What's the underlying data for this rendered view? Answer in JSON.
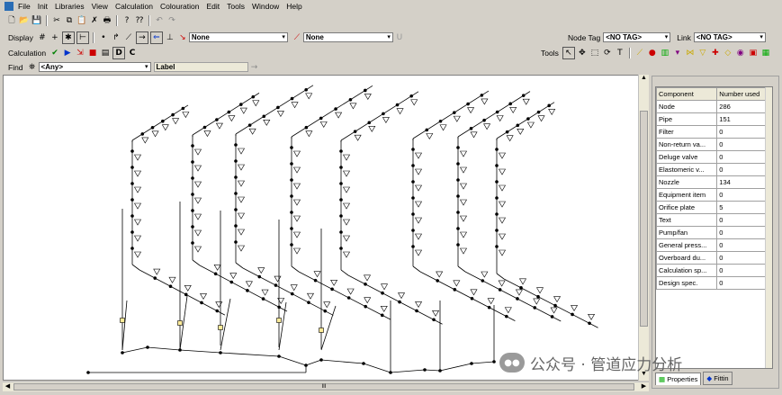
{
  "menu": [
    "File",
    "Init",
    "Libraries",
    "View",
    "Calculation",
    "Colouration",
    "Edit",
    "Tools",
    "Window",
    "Help"
  ],
  "display_toolbar": {
    "label": "Display",
    "combo1_value": "None",
    "combo2_value": "None",
    "node_tag_label": "Node Tag",
    "node_tag_value": "<NO TAG>",
    "link_label": "Link",
    "link_value": "<NO TAG>"
  },
  "calc_toolbar": {
    "label": "Calculation",
    "d_label": "D",
    "c_label": "C",
    "tools_label": "Tools"
  },
  "find_toolbar": {
    "label": "Find",
    "combo_value": "<Any>",
    "field_label": "Label"
  },
  "hscroll_grip": "III",
  "properties_panel": {
    "header": [
      "Component",
      "Number used"
    ],
    "rows": [
      [
        "Node",
        "286"
      ],
      [
        "Pipe",
        "151"
      ],
      [
        "Filter",
        "0"
      ],
      [
        "Non-return va...",
        "0"
      ],
      [
        "Deluge valve",
        "0"
      ],
      [
        "Elastomeric v...",
        "0"
      ],
      [
        "Nozzle",
        "134"
      ],
      [
        "Equipment item",
        "0"
      ],
      [
        "Orifice plate",
        "5"
      ],
      [
        "Text",
        "0"
      ],
      [
        "Pump/fan",
        "0"
      ],
      [
        "General press...",
        "0"
      ],
      [
        "Overboard du...",
        "0"
      ],
      [
        "Calculation sp...",
        "0"
      ],
      [
        "Design spec.",
        "0"
      ]
    ],
    "tabs": [
      "Properties",
      "Fittin"
    ]
  },
  "watermark": "公众号 · 管道应力分析"
}
